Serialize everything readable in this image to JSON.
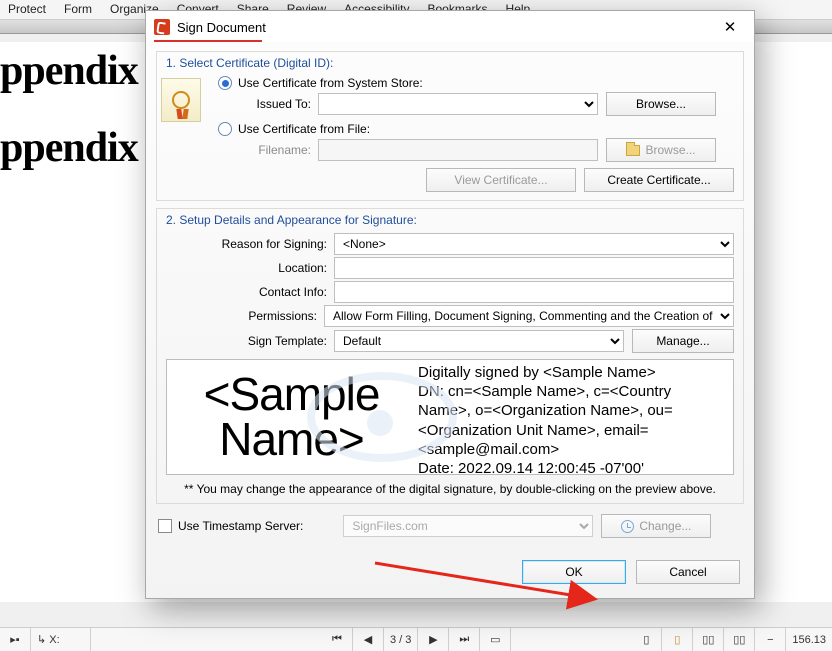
{
  "menubar": [
    "Protect",
    "Form",
    "Organize",
    "Convert",
    "Share",
    "Review",
    "Accessibility",
    "Bookmarks",
    "Help"
  ],
  "background_doc_lines": [
    "ppendix",
    "ppendix"
  ],
  "dialog": {
    "title": "Sign Document",
    "section1_title": "1. Select Certificate (Digital ID):",
    "opt_system_store": "Use Certificate from System Store:",
    "issued_to_label": "Issued To:",
    "browse1": "Browse...",
    "opt_file": "Use Certificate from File:",
    "filename_label": "Filename:",
    "browse2": "Browse...",
    "view_cert": "View Certificate...",
    "create_cert": "Create Certificate...",
    "section2_title": "2. Setup Details and Appearance for Signature:",
    "reason_label": "Reason for Signing:",
    "reason_value": "<None>",
    "location_label": "Location:",
    "contact_label": "Contact Info:",
    "permissions_label": "Permissions:",
    "permissions_value": "Allow Form Filling, Document Signing, Commenting and the Creation of",
    "template_label": "Sign Template:",
    "template_value": "Default",
    "manage": "Manage...",
    "sig_name": "<Sample Name>",
    "sig_block_line1": "Digitally signed by <Sample Name>",
    "sig_block_line2": "DN: cn=<Sample Name>, c=<Country Name>, o=<Organization Name>, ou=<Organization Unit Name>, email=<sample@mail.com>",
    "sig_block_line3": "Date: 2022.09.14 12:00:45 -07'00'",
    "sig_note": "** You may change the appearance of the digital signature, by double-clicking on the preview above.",
    "ts_checkbox": "Use Timestamp Server:",
    "ts_server": "SignFiles.com",
    "ts_change": "Change...",
    "ok": "OK",
    "cancel": "Cancel"
  },
  "statusbar": {
    "coord_label": "X:",
    "page": "3 / 3",
    "zoom": "156.13"
  }
}
